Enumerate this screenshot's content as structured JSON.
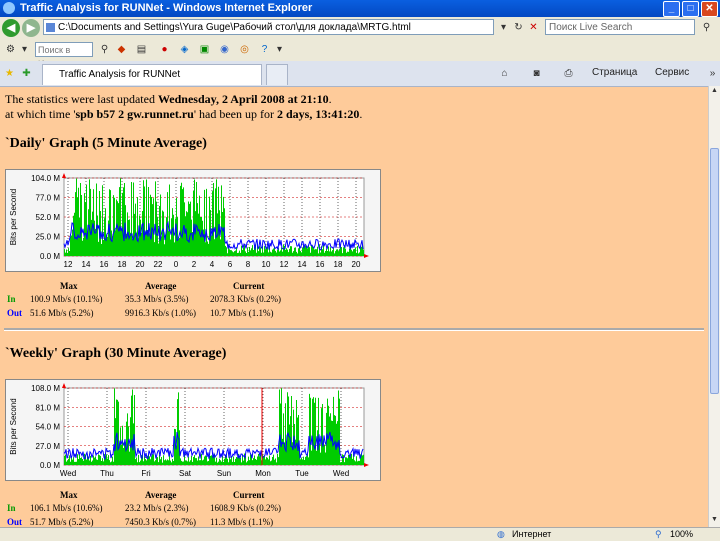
{
  "window": {
    "title": "Traffic Analysis for RUNNet - Windows Internet Explorer",
    "min": "_",
    "max": "□",
    "close": "✕"
  },
  "toolbar": {
    "address": "C:\\Documents and Settings\\Yura Guge\\Рабочий стол\\для доклада\\MRTG.html",
    "search_placeholder": "Поиск Live Search",
    "back": "◀",
    "forward": "▶"
  },
  "links": {
    "search_placeholder": "Поиск в Инт..."
  },
  "tab": {
    "title": "Traffic Analysis for RUNNet"
  },
  "commands": {
    "page": "Страница",
    "service": "Сервис"
  },
  "page": {
    "line1_pre": "The statistics were last updated ",
    "line1_date": "Wednesday, 2 April 2008 at 21:10",
    "line2_pre": "at which time '",
    "line2_host": "spb b57 2 gw.runnet.ru",
    "line2_mid": "' had been up for ",
    "line2_uptime": "2 days, 13:41:20",
    "line2_end": ".",
    "daily": {
      "title": "`Daily' Graph (5 Minute Average)",
      "ylabel": "Bits per Second",
      "yticks": [
        "104.0 M",
        "77.0 M",
        "52.0 M",
        "25.0 M",
        "0.0 M"
      ],
      "xticks": [
        "12",
        "14",
        "16",
        "18",
        "20",
        "22",
        "0",
        "2",
        "4",
        "6",
        "8",
        "10",
        "12",
        "14",
        "16",
        "18",
        "20"
      ],
      "headers": [
        "Max",
        "Average",
        "Current"
      ],
      "rows": [
        {
          "label": "In",
          "max": "100.9 Mb/s (10.1%)",
          "avg": "35.3 Mb/s (3.5%)",
          "cur": "2078.3 Kb/s (0.2%)"
        },
        {
          "label": "Out",
          "max": "51.6 Mb/s (5.2%)",
          "avg": "9916.3 Kb/s (1.0%)",
          "cur": "10.7 Mb/s (1.1%)"
        }
      ]
    },
    "weekly": {
      "title": "`Weekly' Graph (30 Minute Average)",
      "ylabel": "Bits per Second",
      "yticks": [
        "108.0 M",
        "81.0 M",
        "54.0 M",
        "27.0 M",
        "0.0 M"
      ],
      "xticks": [
        "Wed",
        "Thu",
        "Fri",
        "Sat",
        "Sun",
        "Mon",
        "Tue",
        "Wed"
      ],
      "headers": [
        "Max",
        "Average",
        "Current"
      ],
      "rows": [
        {
          "label": "In",
          "max": "106.1 Mb/s (10.6%)",
          "avg": "23.2 Mb/s (2.3%)",
          "cur": "1608.9 Kb/s (0.2%)"
        },
        {
          "label": "Out",
          "max": "51.7 Mb/s (5.2%)",
          "avg": "7450.3 Kb/s (0.7%)",
          "cur": "11.3 Mb/s (1.1%)"
        }
      ]
    }
  },
  "status": {
    "zone": "Интернет",
    "zoom": "100%"
  },
  "colors": {
    "in": "#00cc00",
    "out": "#0000ff",
    "maxout": "#ff00ff",
    "bg": "#fecb9a"
  }
}
